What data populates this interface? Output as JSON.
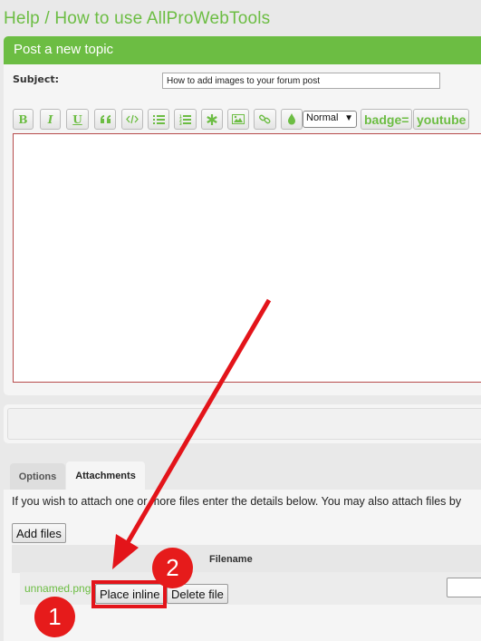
{
  "page": {
    "title": "Help / How to use AllProWebTools"
  },
  "form": {
    "header": "Post a new topic",
    "subject_label": "Subject:",
    "subject_value": "How to add images to your forum post",
    "toolbar": {
      "bold": "B",
      "italic": "I",
      "underline": "U",
      "font_size": "Normal",
      "badge": "badge=",
      "youtube": "youtube"
    },
    "icons": [
      "quote-icon",
      "code-icon",
      "list-icon",
      "ordered-list-icon",
      "asterisk-icon",
      "image-icon",
      "link-icon",
      "color-drop-icon"
    ]
  },
  "tabs": {
    "options": "Options",
    "attachments": "Attachments"
  },
  "attachments": {
    "intro": "If you wish to attach one or more files enter the details below. You may also attach files by",
    "add_files": "Add files",
    "column_filename": "Filename",
    "file": {
      "name": "unnamed.png",
      "place_inline": "Place inline",
      "delete_file": "Delete file"
    }
  },
  "annotations": {
    "step1": "1",
    "step2": "2",
    "arrow_color": "#e3141a"
  },
  "colors": {
    "brand": "#6cbd43",
    "editor_border": "#b74c4c",
    "annotation": "#e61b1b"
  }
}
